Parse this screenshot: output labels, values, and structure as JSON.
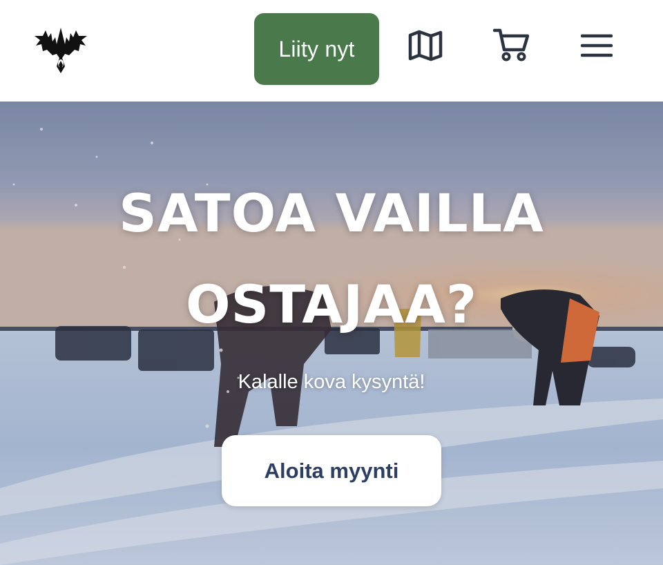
{
  "header": {
    "logo_icon": "thistle-logo-icon",
    "join_label": "Liity nyt",
    "map_icon": "map-icon",
    "cart_icon": "shopping-cart-icon",
    "menu_icon": "hamburger-menu-icon"
  },
  "hero": {
    "title_line1": "SATOA VAILLA",
    "title_line2": "OSTAJAA?",
    "subtitle": "Kalalle kova kysyntä!",
    "cta_label": "Aloita myynti"
  },
  "colors": {
    "join_button_bg": "#4a7a4c",
    "cta_text": "#2c3e62",
    "icon_stroke": "#2c3340"
  }
}
